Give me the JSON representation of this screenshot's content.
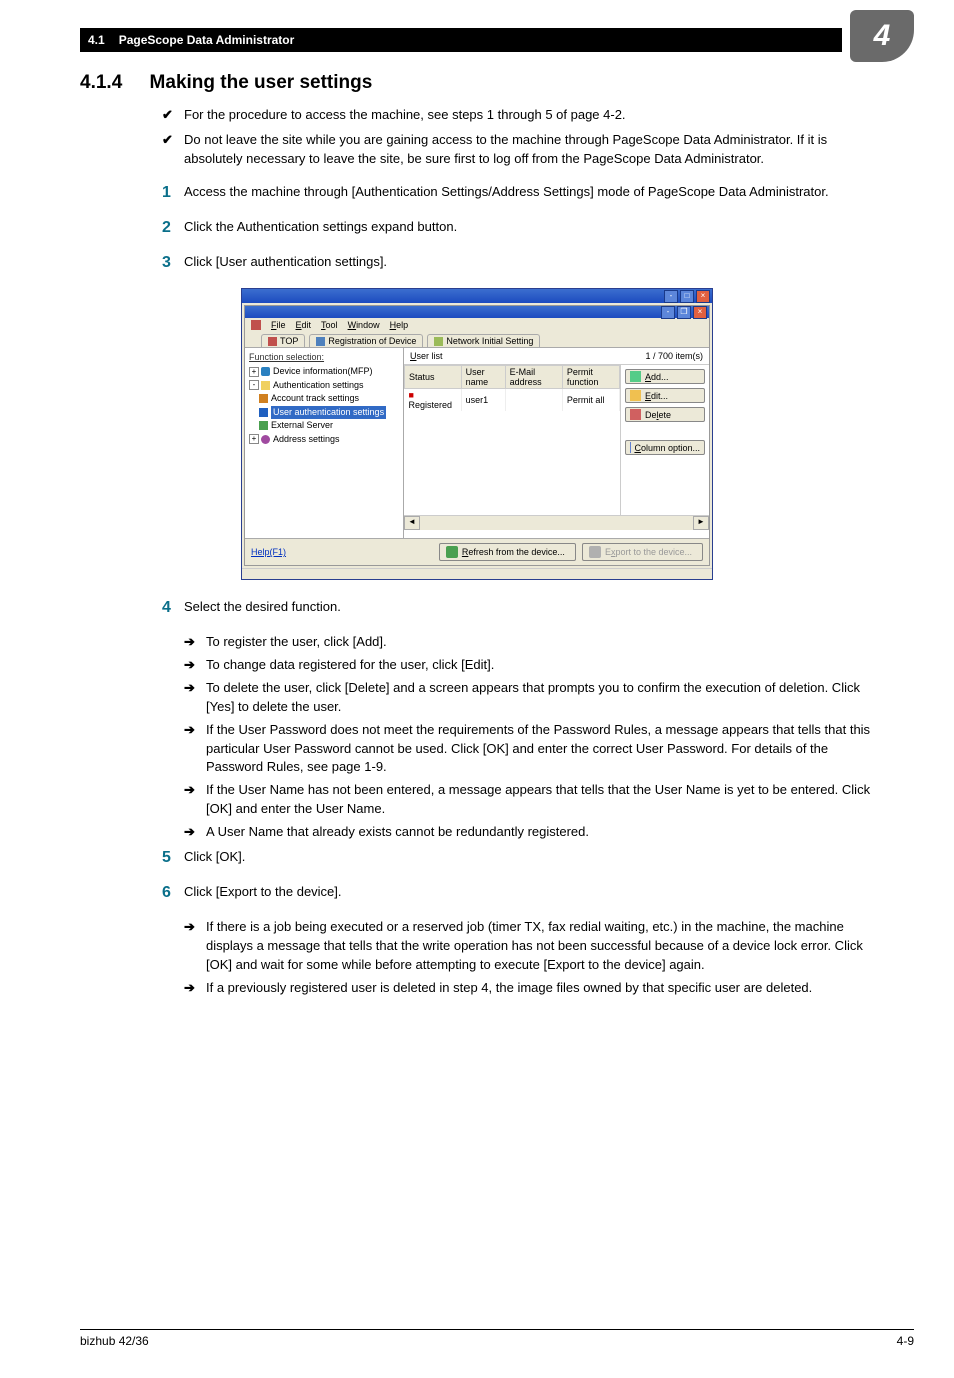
{
  "header": {
    "section": "4.1",
    "title": "PageScope Data Administrator",
    "badge": "4"
  },
  "h2": {
    "num": "4.1.4",
    "text": "Making the user settings"
  },
  "checks": [
    "For the procedure to access the machine, see steps 1 through 5 of page 4-2.",
    "Do not leave the site while you are gaining access to the machine through PageScope Data Administrator. If it is absolutely necessary to leave the site, be sure first to log off from the PageScope Data Administrator."
  ],
  "steps": {
    "s1": "Access the machine through [Authentication Settings/Address Settings] mode of PageScope Data Administrator.",
    "s2": "Click the Authentication settings expand button.",
    "s3": "Click [User authentication settings].",
    "s4": "Select the desired function.",
    "s5": "Click [OK].",
    "s6": "Click [Export to the device]."
  },
  "sub4": [
    "To register the user, click [Add].",
    "To change data registered for the user, click [Edit].",
    "To delete the user, click [Delete] and a screen appears that prompts you to confirm the execution of deletion. Click [Yes] to delete the user.",
    "If the User Password does not meet the requirements of the Password Rules, a message appears that tells that this particular User Password cannot be used. Click [OK] and enter the correct User Password. For details of the Password Rules, see page 1-9.",
    "If the User Name has not been entered, a message appears that tells that the User Name is yet to be entered. Click [OK] and enter the User Name.",
    "A User Name that already exists cannot be redundantly registered."
  ],
  "sub6": [
    "If there is a job being executed or a reserved job (timer TX, fax redial waiting, etc.) in the machine, the machine displays a message that tells that the write operation has not been successful because of a device lock error. Click [OK] and wait for some while before attempting to execute [Export to the device] again.",
    "If a previously registered user is deleted in step 4, the image files owned by that specific user are deleted."
  ],
  "screenshot": {
    "menus": [
      "File",
      "Edit",
      "Tool",
      "Window",
      "Help"
    ],
    "tabs": [
      "TOP",
      "Registration of Device",
      "Network Initial Setting"
    ],
    "func_label": "Function selection:",
    "tree": {
      "dev": "Device information(MFP)",
      "auth": "Authentication settings",
      "acc": "Account track settings",
      "user_sel": "User authentication settings",
      "ext": "External Server",
      "addr": "Address settings"
    },
    "userlist_label": "User list",
    "count": "1 / 700 item(s)",
    "cols": [
      "Status",
      "User name",
      "E-Mail address",
      "Permit function"
    ],
    "row": {
      "status": "Registered",
      "name": "user1",
      "email": "",
      "permit": "Permit all"
    },
    "side": {
      "add": "Add...",
      "edit": "Edit...",
      "delete": "Delete",
      "col": "Column option..."
    },
    "help": "Help(F1)",
    "refresh": "Refresh from the device...",
    "export": "Export to the device..."
  },
  "footer": {
    "left": "bizhub 42/36",
    "right": "4-9"
  }
}
